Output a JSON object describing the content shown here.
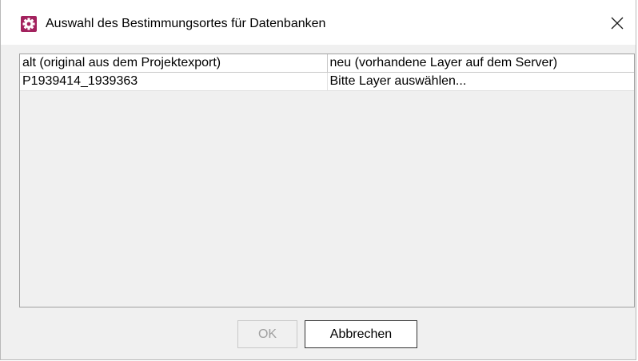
{
  "window": {
    "title": "Auswahl des Bestimmungsortes für Datenbanken",
    "app_icon": "gear-icon",
    "close_icon": "close-icon",
    "accent_color": "#a3225e"
  },
  "table": {
    "columns": [
      "alt (original aus dem Projektexport)",
      "neu (vorhandene Layer auf dem Server)"
    ],
    "rows": [
      [
        "P1939414_1939363",
        "Bitte Layer auswählen..."
      ]
    ]
  },
  "buttons": {
    "ok_label": "OK",
    "ok_enabled": false,
    "cancel_label": "Abbrechen"
  }
}
